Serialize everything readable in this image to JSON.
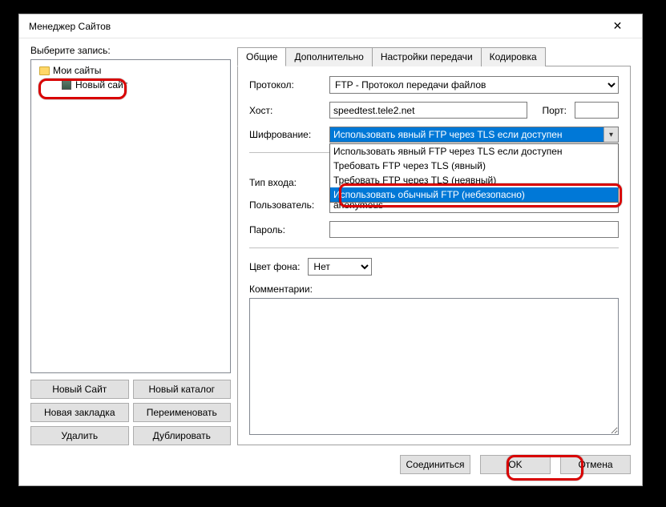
{
  "window": {
    "title": "Менеджер Сайтов"
  },
  "left": {
    "label": "Выберите запись:",
    "root_folder": "Мои сайты",
    "site_name": "Новый сайт",
    "buttons": {
      "new_site": "Новый Сайт",
      "new_folder": "Новый каталог",
      "new_bookmark": "Новая закладка",
      "rename": "Переименовать",
      "delete": "Удалить",
      "duplicate": "Дублировать"
    }
  },
  "tabs": {
    "general": "Общие",
    "advanced": "Дополнительно",
    "transfer": "Настройки передачи",
    "charset": "Кодировка"
  },
  "form": {
    "protocol_label": "Протокол:",
    "protocol_value": "FTP - Протокол передачи файлов",
    "host_label": "Хост:",
    "host_value": "speedtest.tele2.net",
    "port_label": "Порт:",
    "port_value": "",
    "encryption_label": "Шифрование:",
    "encryption_selected": "Использовать явный FTP через TLS если доступен",
    "encryption_options": [
      "Использовать явный FTP через TLS если доступен",
      "Требовать FTP через TLS (явный)",
      "Требовать FTP через TLS (неявный)",
      "Использовать обычный FTP (небезопасно)"
    ],
    "logon_label": "Тип входа:",
    "user_label": "Пользователь:",
    "user_value": "anonymous",
    "pass_label": "Пароль:",
    "bgcolor_label": "Цвет фона:",
    "bgcolor_value": "Нет",
    "comments_label": "Комментарии:"
  },
  "footer": {
    "connect": "Соединиться",
    "ok": "OK",
    "cancel": "Отмена"
  }
}
